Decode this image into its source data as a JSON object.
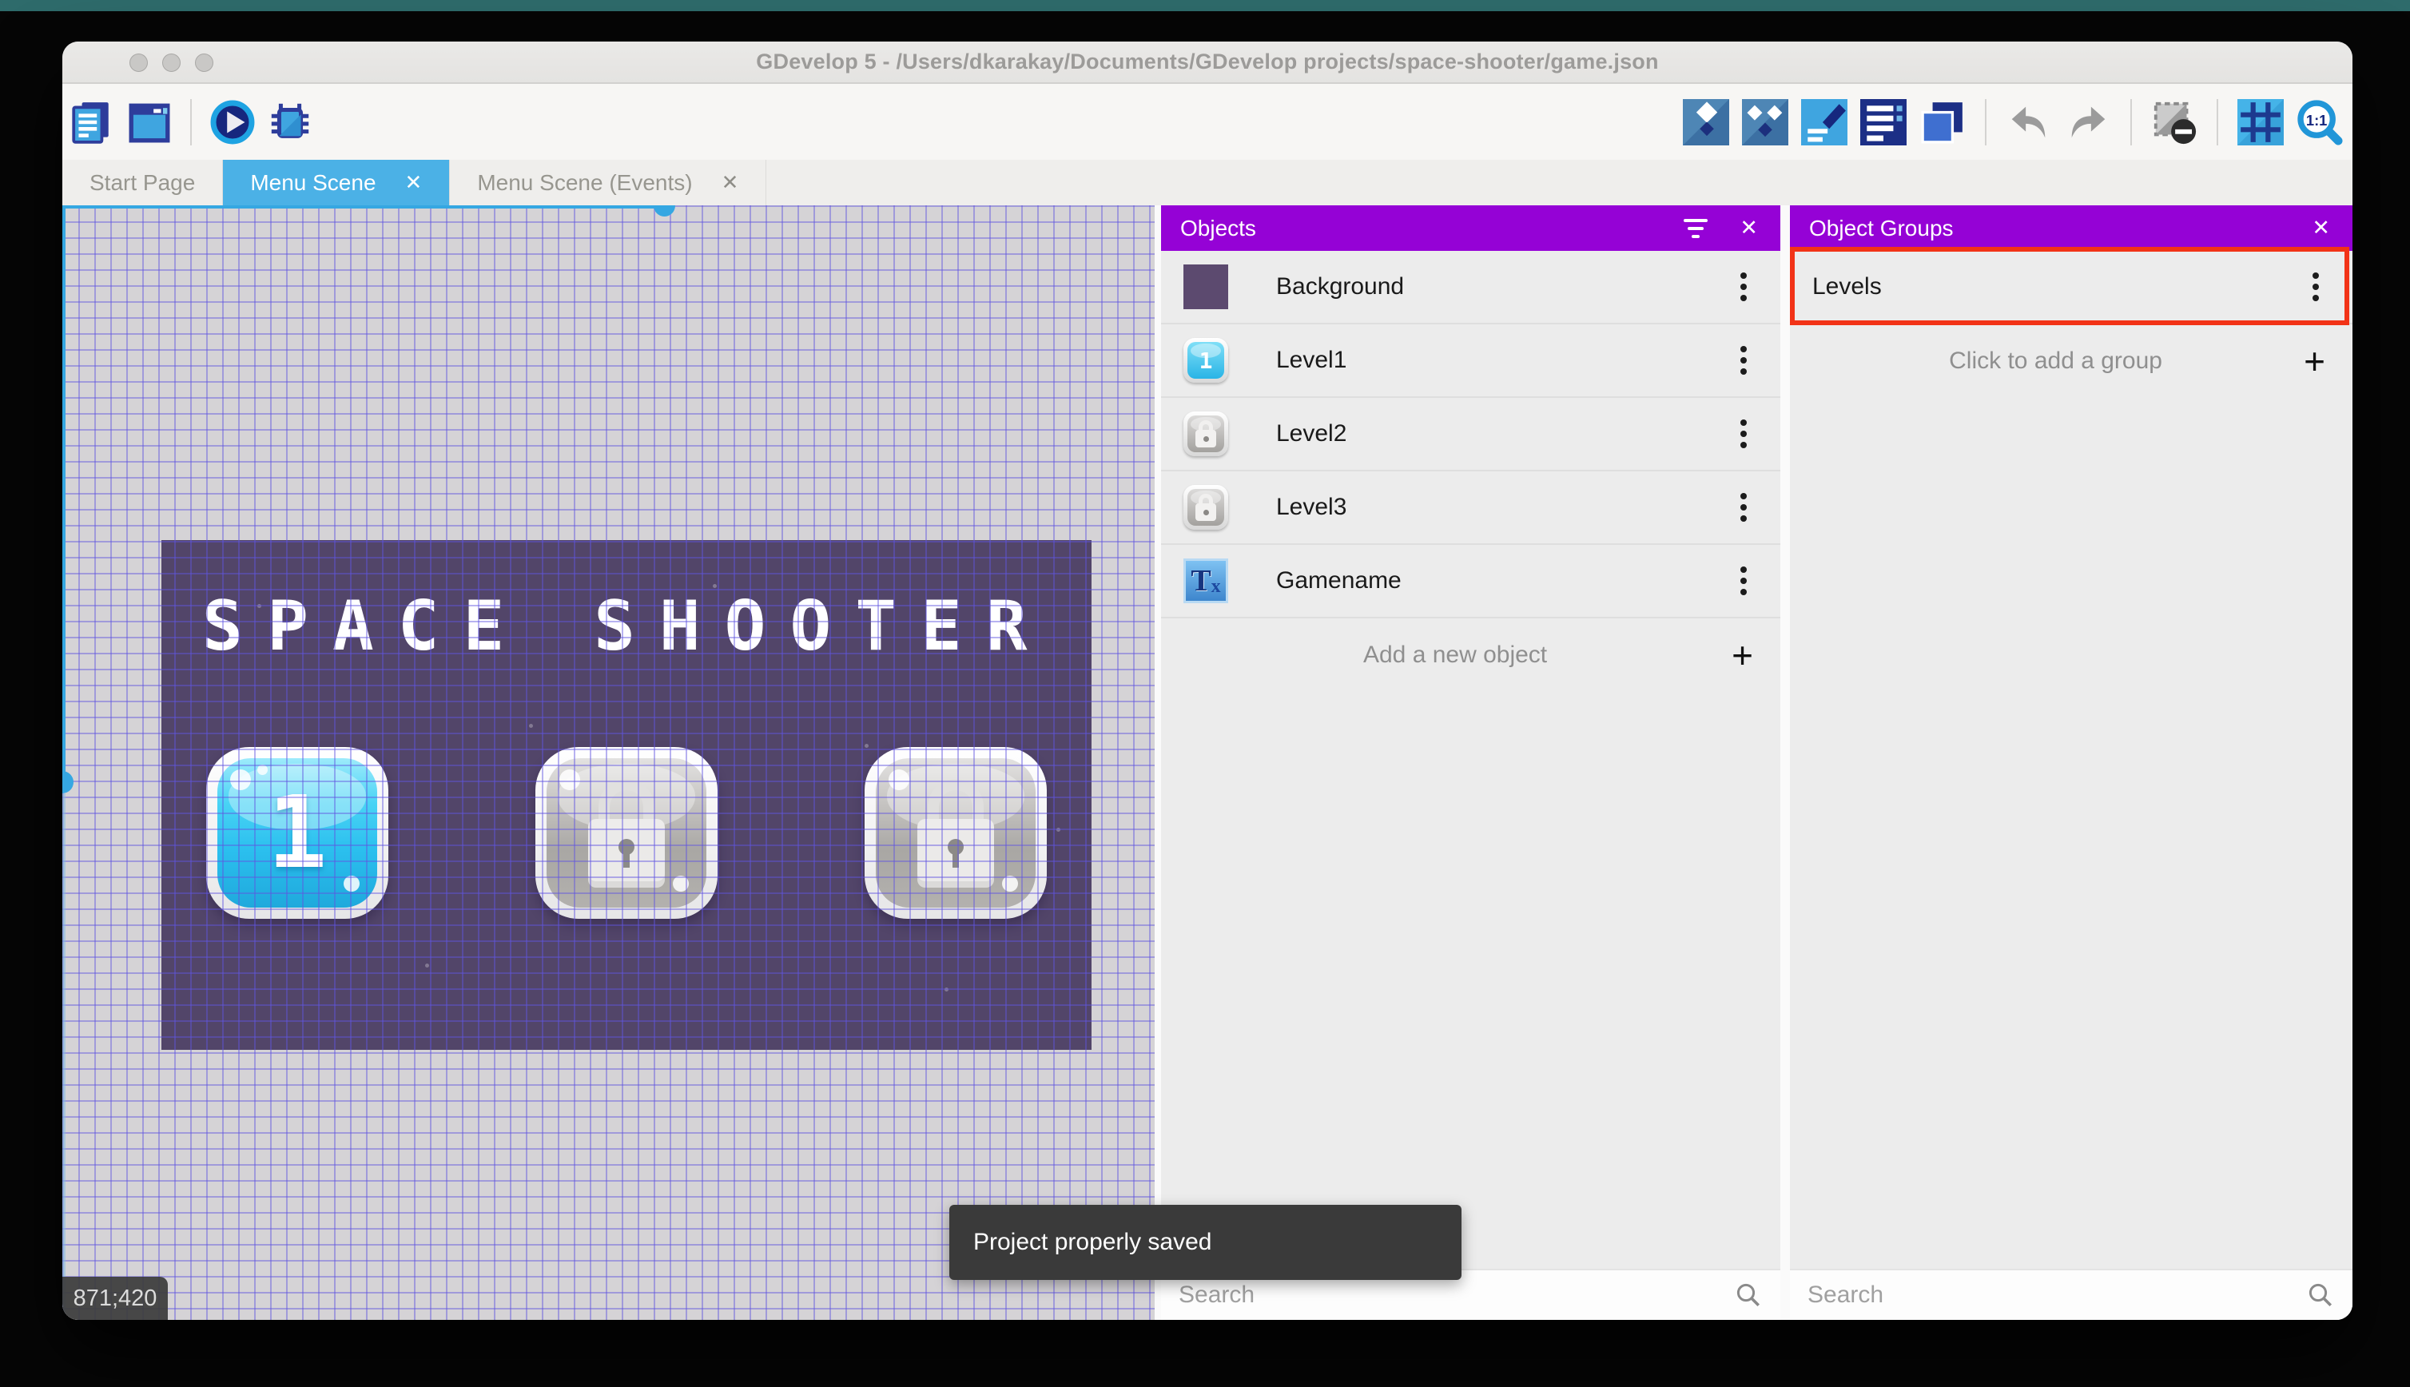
{
  "window": {
    "title": "GDevelop 5 - /Users/dkarakay/Documents/GDevelop projects/space-shooter/game.json"
  },
  "toolbar": {
    "zoom_label": "1:1"
  },
  "tabs": {
    "start": "Start Page",
    "scene": "Menu Scene",
    "events": "Menu Scene (Events)"
  },
  "glyphs": {
    "close": "✕",
    "plus": "+"
  },
  "canvas": {
    "coords": "871;420",
    "scene_title": "SPACE SHOOTER",
    "level1_label": "1"
  },
  "objects": {
    "title": "Objects",
    "rows": [
      {
        "label": "Background"
      },
      {
        "label": "Level1",
        "badge": "1"
      },
      {
        "label": "Level2"
      },
      {
        "label": "Level3"
      },
      {
        "label": "Gamename"
      }
    ],
    "add_label": "Add a new object",
    "search_placeholder": "Search"
  },
  "groups": {
    "title": "Object Groups",
    "rows": [
      {
        "label": "Levels"
      }
    ],
    "add_label": "Click to add a group",
    "search_placeholder": "Search"
  },
  "toast": {
    "message": "Project properly saved"
  },
  "text_icon": {
    "t": "T",
    "x": "x"
  },
  "colors": {
    "accent_purple": "#9502d6",
    "tab_active": "#4bb1e6",
    "annotation_red": "#f23317",
    "scroll_indicator": "#35a7e2"
  }
}
